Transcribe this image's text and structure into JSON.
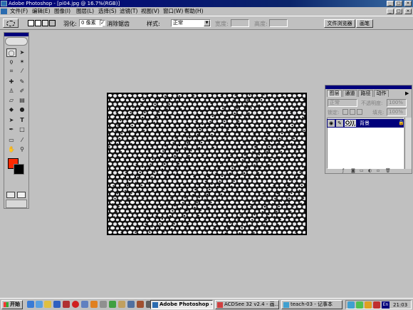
{
  "window": {
    "title": "Adobe Photoshop - [pi04.jpg @ 16.7%(RGB)]"
  },
  "menu": [
    "文件(F)",
    "编辑(E)",
    "图像(I)",
    "图层(L)",
    "选择(S)",
    "滤镜(T)",
    "视图(V)",
    "窗口(W)",
    "帮助(H)"
  ],
  "options": {
    "feather_label": "羽化:",
    "feather_value": "0 像素",
    "antialias_label": "消除锯齿",
    "style_label": "样式:",
    "style_value": "正常",
    "width_label": "宽度:",
    "height_label": "高度:"
  },
  "dock": {
    "tab1": "文件浏览器",
    "tab2": "画笔"
  },
  "layers_panel": {
    "tabs": [
      "图层",
      "通道",
      "路径",
      "动作"
    ],
    "blend_mode": "正常",
    "opacity_label": "不透明度:",
    "opacity_value": "100%",
    "lock_label": "锁定:",
    "fill_label": "填充:",
    "fill_value": "100%",
    "layer_name": "背景"
  },
  "colors": {
    "foreground": "#ff2a00",
    "background": "#000000",
    "titlebar": "#00007b"
  },
  "taskbar": {
    "start_label": "开始",
    "tasks": [
      "Adobe Photoshop - [...",
      "ACDSee 32 v2.4 - 画...",
      "teach-03 - 记事本"
    ],
    "clock": "21:03",
    "ime": "En"
  }
}
